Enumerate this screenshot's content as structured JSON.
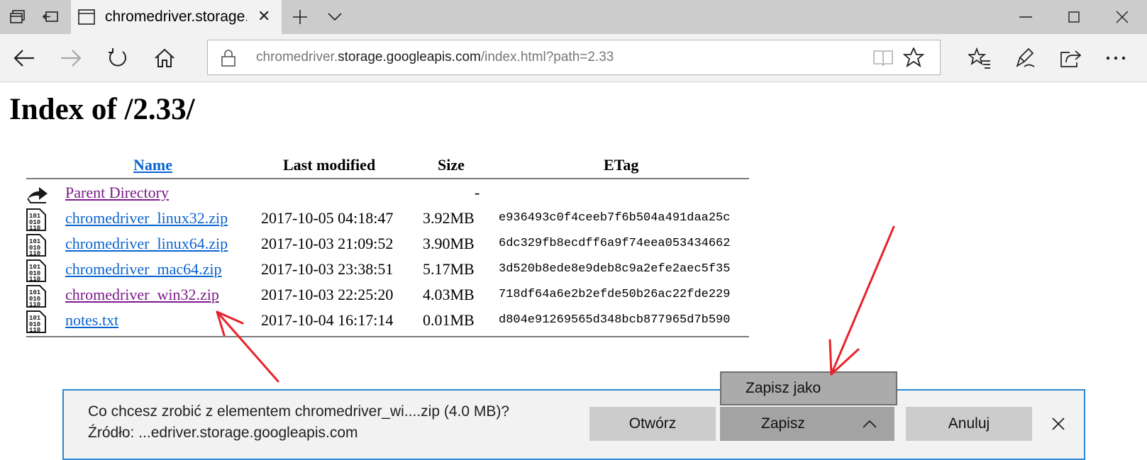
{
  "tab": {
    "title": "chromedriver.storage.googleapis.com"
  },
  "address": {
    "url_prefix": "chromedriver.",
    "url_host": "storage.googleapis.com",
    "url_rest": "/index.html?path=2.33"
  },
  "page": {
    "title": "Index of /2.33/"
  },
  "table": {
    "headers": {
      "name": "Name",
      "modified": "Last modified",
      "size": "Size",
      "etag": "ETag"
    },
    "rows": [
      {
        "name": "Parent Directory",
        "date": "",
        "size": "-",
        "etag": "",
        "icon": "parent-folder-icon",
        "visited": true
      },
      {
        "name": "chromedriver_linux32.zip",
        "date": "2017-10-05 04:18:47",
        "size": "3.92MB",
        "etag": "e936493c0f4ceeb7f6b504a491daa25c",
        "icon": "binary-file-icon",
        "visited": false
      },
      {
        "name": "chromedriver_linux64.zip",
        "date": "2017-10-03 21:09:52",
        "size": "3.90MB",
        "etag": "6dc329fb8ecdff6a9f74eea053434662",
        "icon": "binary-file-icon",
        "visited": false
      },
      {
        "name": "chromedriver_mac64.zip",
        "date": "2017-10-03 23:38:51",
        "size": "5.17MB",
        "etag": "3d520b8ede8e9deb8c9a2efe2aec5f35",
        "icon": "binary-file-icon",
        "visited": false
      },
      {
        "name": "chromedriver_win32.zip",
        "date": "2017-10-03 22:25:20",
        "size": "4.03MB",
        "etag": "718df64a6e2b2efde50b26ac22fde229",
        "icon": "binary-file-icon",
        "visited": true
      },
      {
        "name": "notes.txt",
        "date": "2017-10-04 16:17:14",
        "size": "0.01MB",
        "etag": "d804e91269565d348bcb877965d7b590",
        "icon": "binary-file-icon",
        "visited": false
      }
    ]
  },
  "download": {
    "prompt": "Co chcesz zrobić z elementem chromedriver_wi....zip (4.0 MB)?",
    "source": "Źródło: ...edriver.storage.googleapis.com",
    "open_label": "Otwórz",
    "save_label": "Zapisz",
    "cancel_label": "Anuluj",
    "save_as_label": "Zapisz jako"
  },
  "colors": {
    "link": "#0b63cf",
    "visited": "#7b1a8a",
    "accent": "#2b88d8",
    "annotation": "#e8222a"
  }
}
